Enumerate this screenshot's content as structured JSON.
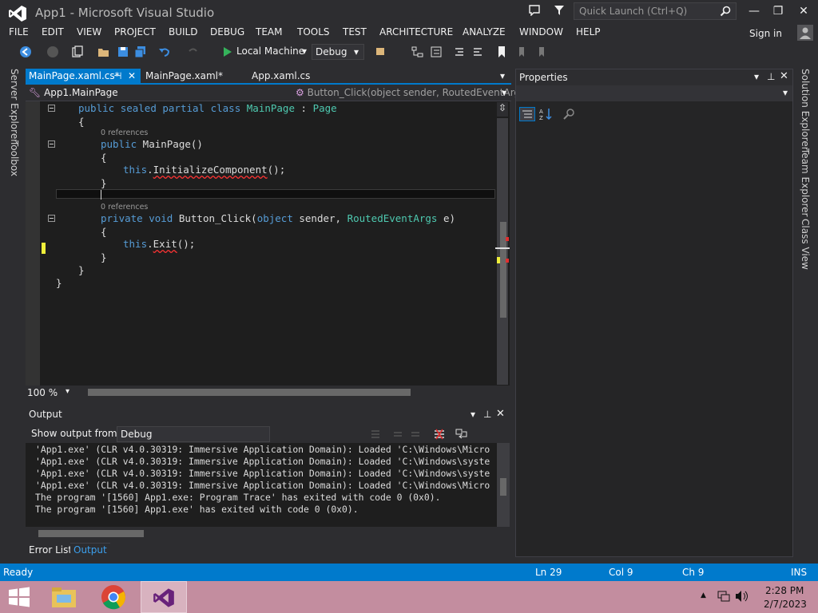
{
  "window": {
    "title": "App1 - Microsoft Visual Studio",
    "minimize": "—",
    "maximize": "❐",
    "close": "✕"
  },
  "quick_launch": {
    "placeholder": "Quick Launch (Ctrl+Q)"
  },
  "menu": [
    "FILE",
    "EDIT",
    "VIEW",
    "PROJECT",
    "BUILD",
    "DEBUG",
    "TEAM",
    "TOOLS",
    "TEST",
    "ARCHITECTURE",
    "ANALYZE",
    "WINDOW",
    "HELP"
  ],
  "signin": "Sign in",
  "toolbar": {
    "run_target": "Local Machine",
    "configuration": "Debug"
  },
  "left_tabs": [
    "Server Explorer",
    "Toolbox"
  ],
  "doc_tabs": [
    {
      "label": "MainPage.xaml.cs*",
      "pin": "⊣",
      "close": "✕"
    },
    {
      "label": "MainPage.xaml*"
    },
    {
      "label": "App.xaml.cs"
    }
  ],
  "nav": {
    "class": "App1.MainPage",
    "member": "Button_Click(object sender, RoutedEventArgs e)"
  },
  "code": {
    "refs1": "0 references",
    "refs2": "0 references"
  },
  "zoom": "100 %",
  "output": {
    "title": "Output",
    "show_label": "Show output from:",
    "source": "Debug",
    "lines": [
      "'App1.exe' (CLR v4.0.30319: Immersive Application Domain): Loaded 'C:\\Windows\\Micro",
      "'App1.exe' (CLR v4.0.30319: Immersive Application Domain): Loaded 'C:\\Windows\\syste",
      "'App1.exe' (CLR v4.0.30319: Immersive Application Domain): Loaded 'C:\\Windows\\syste",
      "'App1.exe' (CLR v4.0.30319: Immersive Application Domain): Loaded 'C:\\Windows\\Micro",
      "The program '[1560] App1.exe: Program Trace' has exited with code 0 (0x0).",
      "The program '[1560] App1.exe' has exited with code 0 (0x0)."
    ]
  },
  "bottom_tabs": [
    "Error List",
    "Output"
  ],
  "properties": {
    "title": "Properties"
  },
  "right_tabs": [
    "Solution Explorer",
    "Team Explorer",
    "Class View"
  ],
  "status": {
    "state": "Ready",
    "line": "Ln 29",
    "col": "Col 9",
    "ch": "Ch 9",
    "mode": "INS"
  },
  "taskbar": {
    "time": "2:28 PM",
    "date": "2/7/2023"
  },
  "colors": {
    "accent": "#007acc",
    "keyword": "#569cd6",
    "type": "#4ec9b0",
    "taskbar": "#c38d9f"
  }
}
